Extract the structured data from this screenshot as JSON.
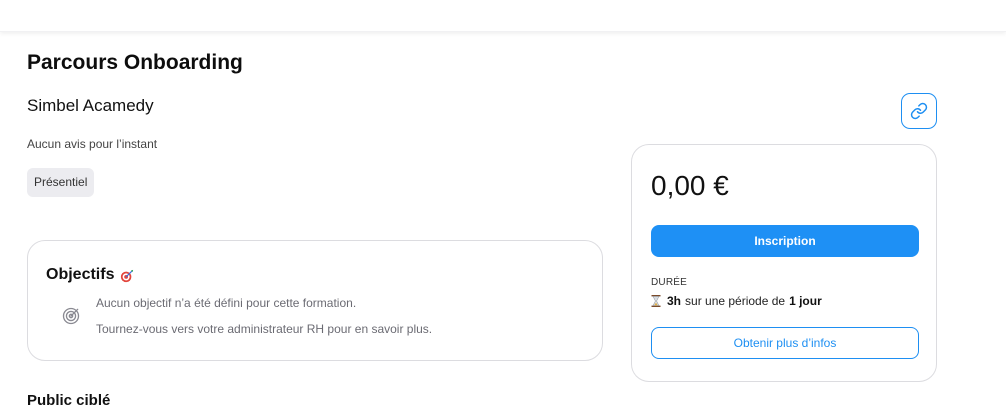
{
  "course": {
    "title": "Parcours Onboarding",
    "provider": "Simbel Acamedy",
    "reviews": "Aucun avis pour l’instant",
    "tag": "Présentiel"
  },
  "objectives": {
    "title": "Objectifs",
    "title_icon": "target-dart-icon",
    "icon": "target-icon",
    "line1": "Aucun objectif n’a été défini pour cette formation.",
    "line2": "Tournez-vous vers votre administrateur RH pour en savoir plus."
  },
  "public": {
    "title": "Public ciblé"
  },
  "pricing": {
    "price": "0,00 €",
    "signup_label": "Inscription",
    "duration_label": "DURÉE",
    "duration_icon": "hourglass-icon",
    "duration_value": "3h",
    "duration_text": "sur une période de",
    "duration_period": "1 jour",
    "info_label": "Obtenir plus d’infos"
  },
  "share": {
    "icon": "link-icon"
  },
  "colors": {
    "accent": "#1e90f5",
    "tag_bg": "#ececf0",
    "border": "#dcdce0",
    "muted_text": "#6b6b73"
  }
}
